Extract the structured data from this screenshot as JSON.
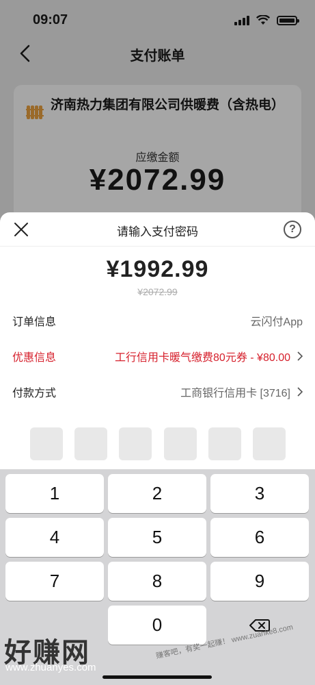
{
  "status": {
    "time": "09:07"
  },
  "nav": {
    "title": "支付账单",
    "back_icon": "chevron-left-icon"
  },
  "bill": {
    "merchant": "济南热力集团有限公司供暖费（含热电）",
    "amount_label": "应缴金额",
    "amount": "¥2072.99"
  },
  "sheet": {
    "title": "请输入支付密码",
    "pay_amount": "¥1992.99",
    "original_amount": "¥2072.99",
    "rows": [
      {
        "label": "订单信息",
        "value": "云闪付App"
      },
      {
        "label": "优惠信息",
        "value": "工行信用卡暖气缴费80元券 - ¥80.00"
      },
      {
        "label": "付款方式",
        "value": "工商银行信用卡 [3716]"
      }
    ],
    "promo_color": "#d6202c"
  },
  "keypad": {
    "keys": [
      "1",
      "2",
      "3",
      "4",
      "5",
      "6",
      "7",
      "8",
      "9",
      "0"
    ],
    "delete_icon": "backspace-icon"
  },
  "watermark": {
    "brand": "好赚网",
    "url": "www.zhuanyes.com",
    "stamp": "赚客吧，有奖一起赚！ www.zuanke8.com"
  }
}
